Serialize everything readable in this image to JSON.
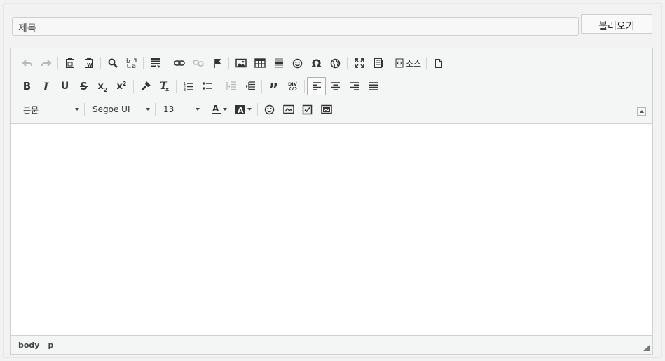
{
  "form": {
    "title_placeholder": "제목",
    "load_button": "불러오기"
  },
  "toolbar": {
    "row1": [
      "undo-icon",
      "redo-icon",
      "paste-icon",
      "paste-from-word-icon",
      "find-icon",
      "replace-icon",
      "select-all-icon",
      "link-icon",
      "unlink-icon",
      "anchor-icon",
      "image-icon",
      "table-icon",
      "horizontal-rule-icon",
      "smiley-icon",
      "special-char-icon",
      "iframe-icon",
      "maximize-icon",
      "show-blocks-icon",
      "source-icon",
      "new-page-icon"
    ],
    "source_label": "소스",
    "row2": [
      "bold-icon",
      "italic-icon",
      "underline-icon",
      "strike-icon",
      "subscript-icon",
      "superscript-icon",
      "copy-format-icon",
      "remove-format-icon",
      "numbered-list-icon",
      "bulleted-list-icon",
      "outdent-icon",
      "indent-icon",
      "blockquote-icon",
      "div-icon",
      "align-left-icon",
      "align-center-icon",
      "align-right-icon",
      "justify-icon"
    ],
    "format_value": "본문",
    "font_value": "Segoe UI",
    "size_value": "13",
    "row3": [
      "text-color-icon",
      "background-color-icon",
      "emoji-icon",
      "image-plugin-icon",
      "checkbox-icon",
      "image-alt-icon"
    ]
  },
  "statusbar": {
    "path": [
      "body",
      "p"
    ]
  },
  "colors": {
    "toolbar_bg": "#f4f5f5",
    "border": "#d1d1d1",
    "icon": "#333333"
  }
}
